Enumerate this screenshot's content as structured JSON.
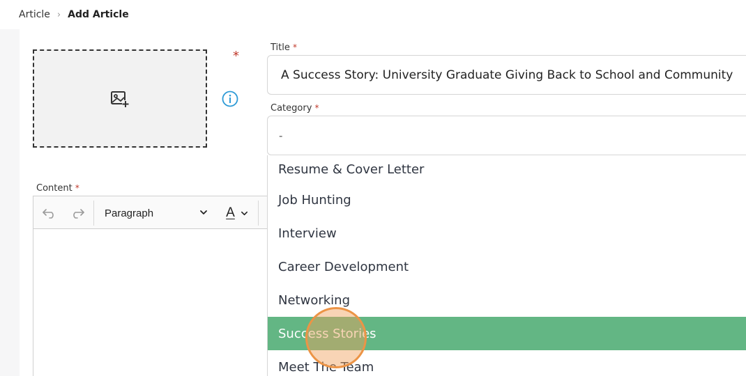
{
  "breadcrumb": {
    "items": [
      "Article",
      "Add Article"
    ]
  },
  "image_upload": {
    "icon": "image-add-icon",
    "required_mark": "*"
  },
  "form": {
    "title_label": "Title",
    "title_value": "A Success Story: University Graduate Giving Back to School and Community",
    "category_label": "Category",
    "category_value": "-",
    "content_label": "Content",
    "required_mark": "*"
  },
  "editor": {
    "paragraph_style": "Paragraph",
    "font_color_glyph": "A"
  },
  "category_options": [
    "Resume & Cover Letter",
    "Job Hunting",
    "Interview",
    "Career Development",
    "Networking",
    "Success Stories",
    "Meet The Team"
  ],
  "selected_option": "Success Stories",
  "colors": {
    "selected_bg": "#63b684",
    "info_icon": "#2d9ad6",
    "required": "#c0392b",
    "cursor": "#ec9446"
  }
}
